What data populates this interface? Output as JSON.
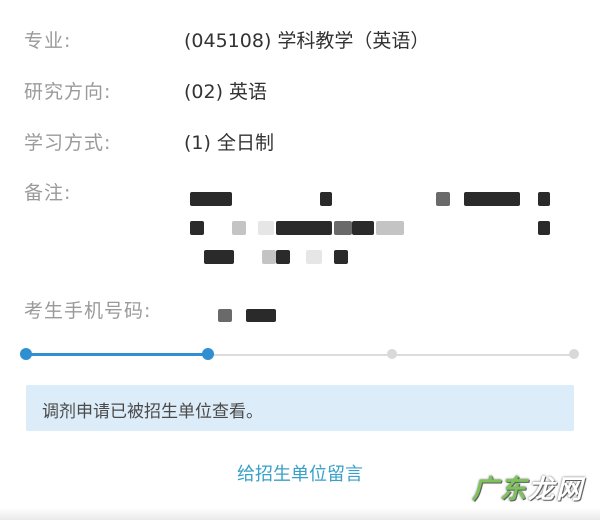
{
  "fields": [
    {
      "label": "专业:",
      "value": "(045108) 学科教学（英语）"
    },
    {
      "label": "研究方向:",
      "value": "(02) 英语"
    },
    {
      "label": "学习方式:",
      "value": "(1) 全日制"
    },
    {
      "label": "备注:",
      "value": ""
    },
    {
      "label": "考生手机号码:",
      "value": ""
    }
  ],
  "progress": {
    "steps_total": 4,
    "steps_completed": 2,
    "colors": {
      "done": "#2f8fd0",
      "pending": "#d9d9d9"
    }
  },
  "notice": {
    "text": "调剂申请已被招生单位查看。",
    "background": "#dcecf8"
  },
  "action": {
    "label": "给招生单位留言",
    "color": "#3aa0c8"
  },
  "watermark": {
    "text_green": "广东",
    "text_white": "龙网"
  }
}
